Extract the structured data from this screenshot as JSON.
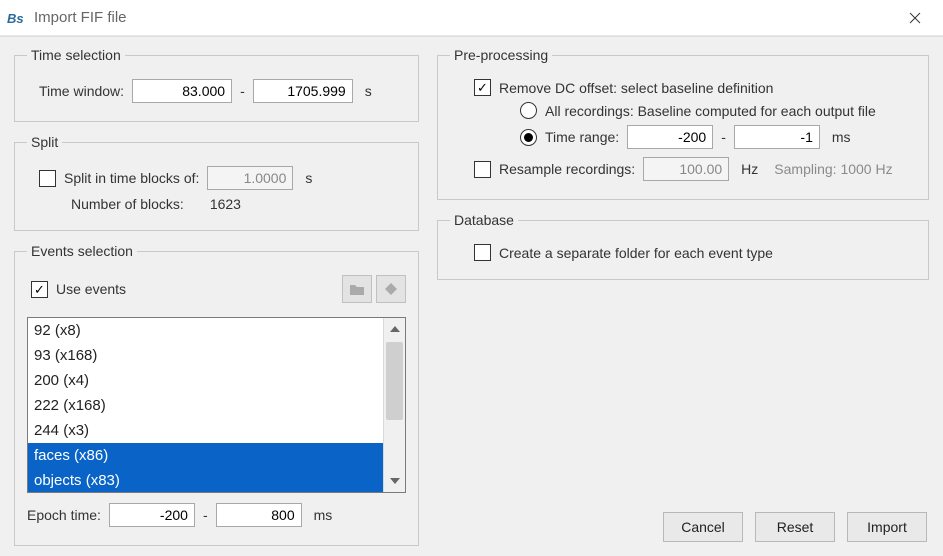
{
  "window": {
    "title": "Import FIF file",
    "app_logo_text": "Bs"
  },
  "time_selection": {
    "legend": "Time selection",
    "time_window_label": "Time window:",
    "start": "83.000",
    "end": "1705.999",
    "sep": "-",
    "unit": "s"
  },
  "split": {
    "legend": "Split",
    "checkbox_label": "Split in time blocks of:",
    "checked": false,
    "block_value": "1.0000",
    "unit": "s",
    "blocks_label": "Number of blocks:",
    "blocks_value": "1623"
  },
  "events": {
    "legend": "Events selection",
    "use_events_label": "Use events",
    "use_events_checked": true,
    "items": [
      {
        "label": "92 (x8)",
        "selected": false
      },
      {
        "label": "93 (x168)",
        "selected": false
      },
      {
        "label": "200 (x4)",
        "selected": false
      },
      {
        "label": "222 (x168)",
        "selected": false
      },
      {
        "label": "244 (x3)",
        "selected": false
      },
      {
        "label": "faces (x86)",
        "selected": true
      },
      {
        "label": "objects (x83)",
        "selected": true
      }
    ],
    "epoch_label": "Epoch time:",
    "epoch_start": "-200",
    "epoch_end": "800",
    "epoch_sep": "-",
    "epoch_unit": "ms"
  },
  "pre": {
    "legend": "Pre-processing",
    "dc_checked": true,
    "dc_label": "Remove DC offset: select baseline definition",
    "radio_all_label": "All recordings: Baseline computed for each output file",
    "radio_all_selected": false,
    "radio_range_label": "Time range:",
    "radio_range_selected": true,
    "range_start": "-200",
    "range_end": "-1",
    "range_sep": "-",
    "range_unit": "ms",
    "resample_checked": false,
    "resample_label": "Resample recordings:",
    "resample_value": "100.00",
    "resample_unit": "Hz",
    "sampling_info": "Sampling: 1000 Hz"
  },
  "db": {
    "legend": "Database",
    "checkbox_label": "Create a separate folder for each event type",
    "checked": false
  },
  "buttons": {
    "cancel": "Cancel",
    "reset": "Reset",
    "import": "Import"
  },
  "icons": {
    "folder": "folder-icon",
    "diamond": "diamond-icon"
  }
}
